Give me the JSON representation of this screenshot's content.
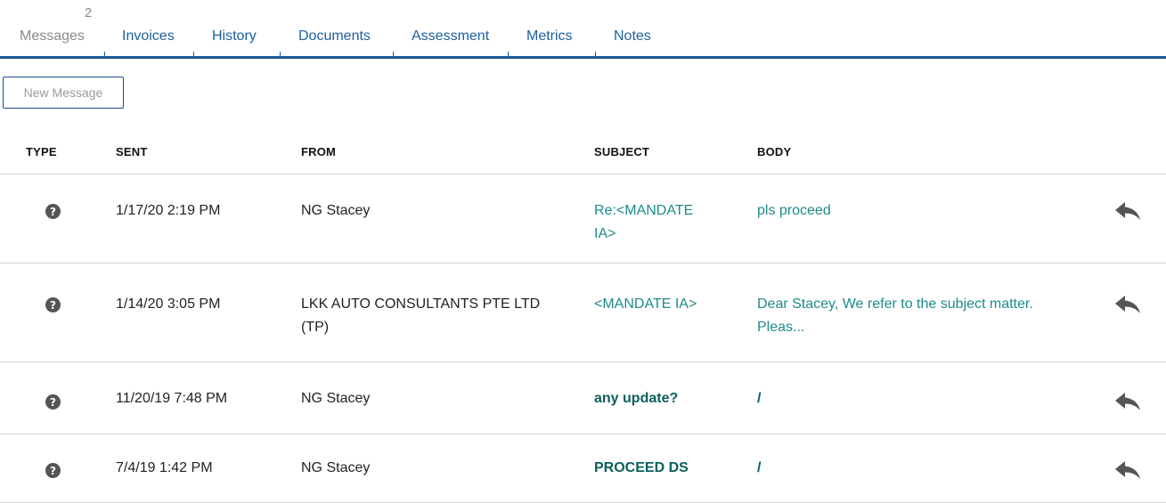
{
  "tabs": [
    {
      "label": "Messages",
      "badge": "2",
      "active": true
    },
    {
      "label": "Invoices"
    },
    {
      "label": "History"
    },
    {
      "label": "Documents"
    },
    {
      "label": "Assessment"
    },
    {
      "label": "Metrics"
    },
    {
      "label": "Notes"
    }
  ],
  "new_message_label": "New Message",
  "columns": {
    "type": "TYPE",
    "sent": "SENT",
    "from": "FROM",
    "subject": "SUBJECT",
    "body": "BODY"
  },
  "messages": [
    {
      "type_icon": "question-circle-icon",
      "sent": "1/17/20 2:19 PM",
      "from": "NG Stacey",
      "subject": "Re:<MANDATE IA>",
      "body": "pls proceed",
      "unread": false
    },
    {
      "type_icon": "question-circle-icon",
      "sent": "1/14/20 3:05 PM",
      "from": "LKK AUTO CONSULTANTS PTE LTD (TP)",
      "subject": "<MANDATE IA>",
      "body": "Dear Stacey, We refer to the subject matter. Pleas...",
      "unread": false
    },
    {
      "type_icon": "question-circle-icon",
      "sent": "11/20/19 7:48 PM",
      "from": "NG Stacey",
      "subject": "any update?",
      "body": "/",
      "unread": true
    },
    {
      "type_icon": "question-circle-icon",
      "sent": "7/4/19 1:42 PM",
      "from": "NG Stacey",
      "subject": "PROCEED DS",
      "body": "/",
      "unread": true
    }
  ],
  "colors": {
    "tab_link": "#1c5f9e",
    "tab_underline": "#1b5a91",
    "subject_link": "#1f8a8a",
    "unread_text": "#0b5e5e"
  }
}
